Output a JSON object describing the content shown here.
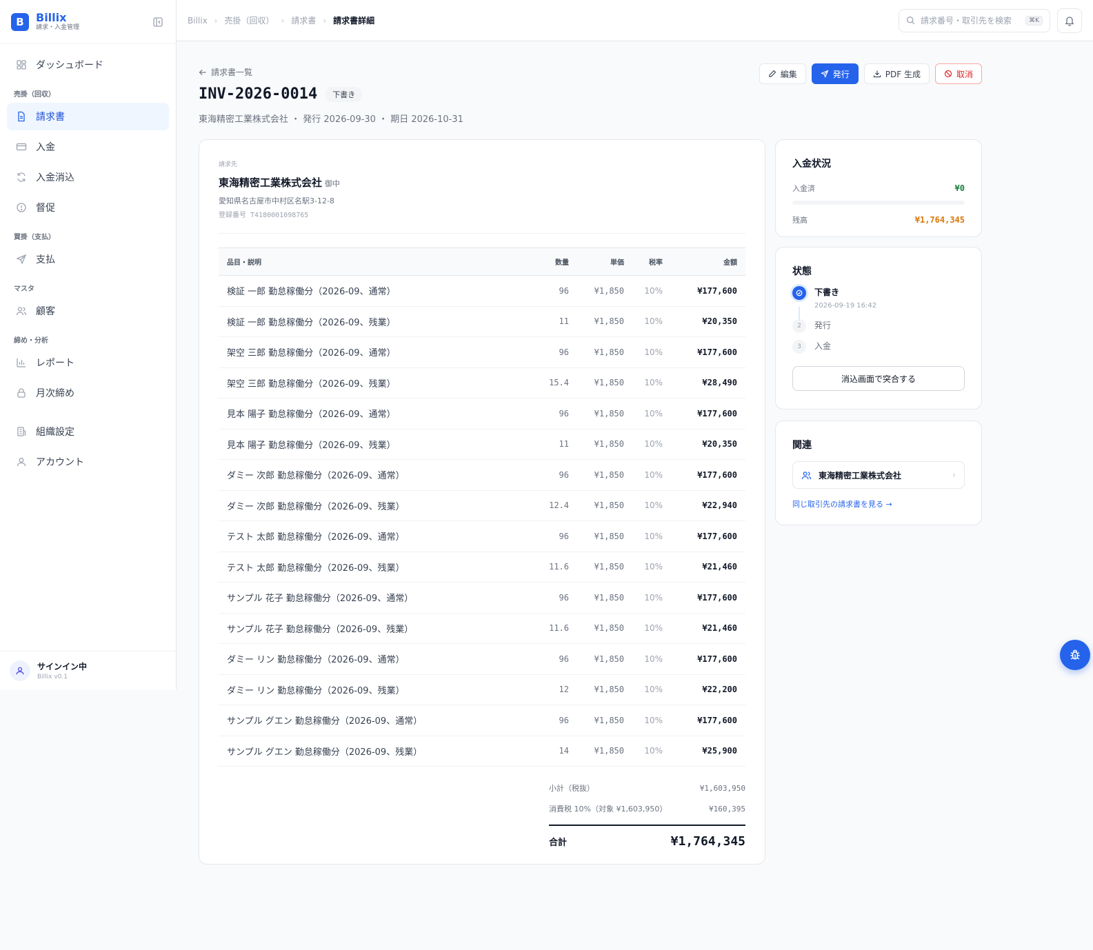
{
  "brand": {
    "logo_letter": "B",
    "name": "Billix",
    "subtitle": "請求・入金管理"
  },
  "sidebar": {
    "top_items": [
      {
        "label": "ダッシュボード",
        "icon": "dashboard-icon"
      }
    ],
    "sections": [
      {
        "title": "売掛（回収）",
        "items": [
          {
            "label": "請求書",
            "icon": "file-text-icon",
            "active": true
          },
          {
            "label": "入金",
            "icon": "credit-card-icon"
          },
          {
            "label": "入金消込",
            "icon": "refresh-icon"
          },
          {
            "label": "督促",
            "icon": "alert-circle-icon"
          }
        ]
      },
      {
        "title": "買掛（支払）",
        "items": [
          {
            "label": "支払",
            "icon": "send-icon"
          }
        ]
      },
      {
        "title": "マスタ",
        "items": [
          {
            "label": "顧客",
            "icon": "users-icon"
          }
        ]
      },
      {
        "title": "締め・分析",
        "items": [
          {
            "label": "レポート",
            "icon": "bar-chart-icon"
          },
          {
            "label": "月次締め",
            "icon": "lock-icon"
          }
        ]
      }
    ],
    "bottom_items": [
      {
        "label": "組織設定",
        "icon": "building-icon"
      },
      {
        "label": "アカウント",
        "icon": "user-icon"
      }
    ],
    "footer": {
      "title": "サインイン中",
      "version": "Billix v0.1"
    }
  },
  "header": {
    "breadcrumbs": [
      "Billix",
      "売掛（回収）",
      "請求書",
      "請求書詳細"
    ],
    "search_placeholder": "請求番号・取引先を検索",
    "search_shortcut": "⌘K"
  },
  "invoice": {
    "back_label": "請求書一覧",
    "number": "INV-2026-0014",
    "status_badge": "下書き",
    "meta": "東海精密工業株式会社 ・ 発行 2026-09-30 ・ 期日 2026-10-31",
    "actions": {
      "edit": "編集",
      "issue": "発行",
      "pdf": "PDF 生成",
      "cancel": "取消"
    },
    "bill_to": {
      "label": "請求先",
      "name": "東海精密工業株式会社",
      "honorific": "御中",
      "address": "愛知県名古屋市中村区名駅3-12-8",
      "registration": "登録番号 T4180001098765"
    },
    "columns": {
      "desc": "品目・説明",
      "qty": "数量",
      "price": "単価",
      "tax": "税率",
      "amount": "金額"
    },
    "items": [
      {
        "desc": "検証 一郎 勤怠稼働分（2026-09、通常）",
        "qty": "96",
        "price": "¥1,850",
        "tax": "10%",
        "amount": "¥177,600"
      },
      {
        "desc": "検証 一郎 勤怠稼働分（2026-09、残業）",
        "qty": "11",
        "price": "¥1,850",
        "tax": "10%",
        "amount": "¥20,350"
      },
      {
        "desc": "架空 三郎 勤怠稼働分（2026-09、通常）",
        "qty": "96",
        "price": "¥1,850",
        "tax": "10%",
        "amount": "¥177,600"
      },
      {
        "desc": "架空 三郎 勤怠稼働分（2026-09、残業）",
        "qty": "15.4",
        "price": "¥1,850",
        "tax": "10%",
        "amount": "¥28,490"
      },
      {
        "desc": "見本 陽子 勤怠稼働分（2026-09、通常）",
        "qty": "96",
        "price": "¥1,850",
        "tax": "10%",
        "amount": "¥177,600"
      },
      {
        "desc": "見本 陽子 勤怠稼働分（2026-09、残業）",
        "qty": "11",
        "price": "¥1,850",
        "tax": "10%",
        "amount": "¥20,350"
      },
      {
        "desc": "ダミー 次郎 勤怠稼働分（2026-09、通常）",
        "qty": "96",
        "price": "¥1,850",
        "tax": "10%",
        "amount": "¥177,600"
      },
      {
        "desc": "ダミー 次郎 勤怠稼働分（2026-09、残業）",
        "qty": "12.4",
        "price": "¥1,850",
        "tax": "10%",
        "amount": "¥22,940"
      },
      {
        "desc": "テスト 太郎 勤怠稼働分（2026-09、通常）",
        "qty": "96",
        "price": "¥1,850",
        "tax": "10%",
        "amount": "¥177,600"
      },
      {
        "desc": "テスト 太郎 勤怠稼働分（2026-09、残業）",
        "qty": "11.6",
        "price": "¥1,850",
        "tax": "10%",
        "amount": "¥21,460"
      },
      {
        "desc": "サンプル 花子 勤怠稼働分（2026-09、通常）",
        "qty": "96",
        "price": "¥1,850",
        "tax": "10%",
        "amount": "¥177,600"
      },
      {
        "desc": "サンプル 花子 勤怠稼働分（2026-09、残業）",
        "qty": "11.6",
        "price": "¥1,850",
        "tax": "10%",
        "amount": "¥21,460"
      },
      {
        "desc": "ダミー リン 勤怠稼働分（2026-09、通常）",
        "qty": "96",
        "price": "¥1,850",
        "tax": "10%",
        "amount": "¥177,600"
      },
      {
        "desc": "ダミー リン 勤怠稼働分（2026-09、残業）",
        "qty": "12",
        "price": "¥1,850",
        "tax": "10%",
        "amount": "¥22,200"
      },
      {
        "desc": "サンプル グエン 勤怠稼働分（2026-09、通常）",
        "qty": "96",
        "price": "¥1,850",
        "tax": "10%",
        "amount": "¥177,600"
      },
      {
        "desc": "サンプル グエン 勤怠稼働分（2026-09、残業）",
        "qty": "14",
        "price": "¥1,850",
        "tax": "10%",
        "amount": "¥25,900"
      }
    ],
    "totals": {
      "subtotal_label": "小計（税抜）",
      "subtotal": "¥1,603,950",
      "tax_label": "消費税 10%（対象 ¥1,603,950）",
      "tax": "¥160,395",
      "total_label": "合計",
      "total": "¥1,764,345"
    }
  },
  "payment_status": {
    "title": "入金状況",
    "paid_label": "入金済",
    "paid": "¥0",
    "balance_label": "残高",
    "balance": "¥1,764,345",
    "paid_ratio": 0,
    "colors": {
      "paid": "#15803d",
      "balance": "#d97706"
    }
  },
  "state": {
    "title": "状態",
    "steps": [
      {
        "num": "1",
        "label": "下書き",
        "time": "2026-09-19 16:42",
        "done": true
      },
      {
        "num": "2",
        "label": "発行",
        "done": false
      },
      {
        "num": "3",
        "label": "入金",
        "done": false
      }
    ],
    "reconcile_button": "消込画面で突合する"
  },
  "related": {
    "title": "関連",
    "customer": "東海精密工業株式会社",
    "link": "同じ取引先の請求書を見る →"
  },
  "accent_color": "#2563eb"
}
